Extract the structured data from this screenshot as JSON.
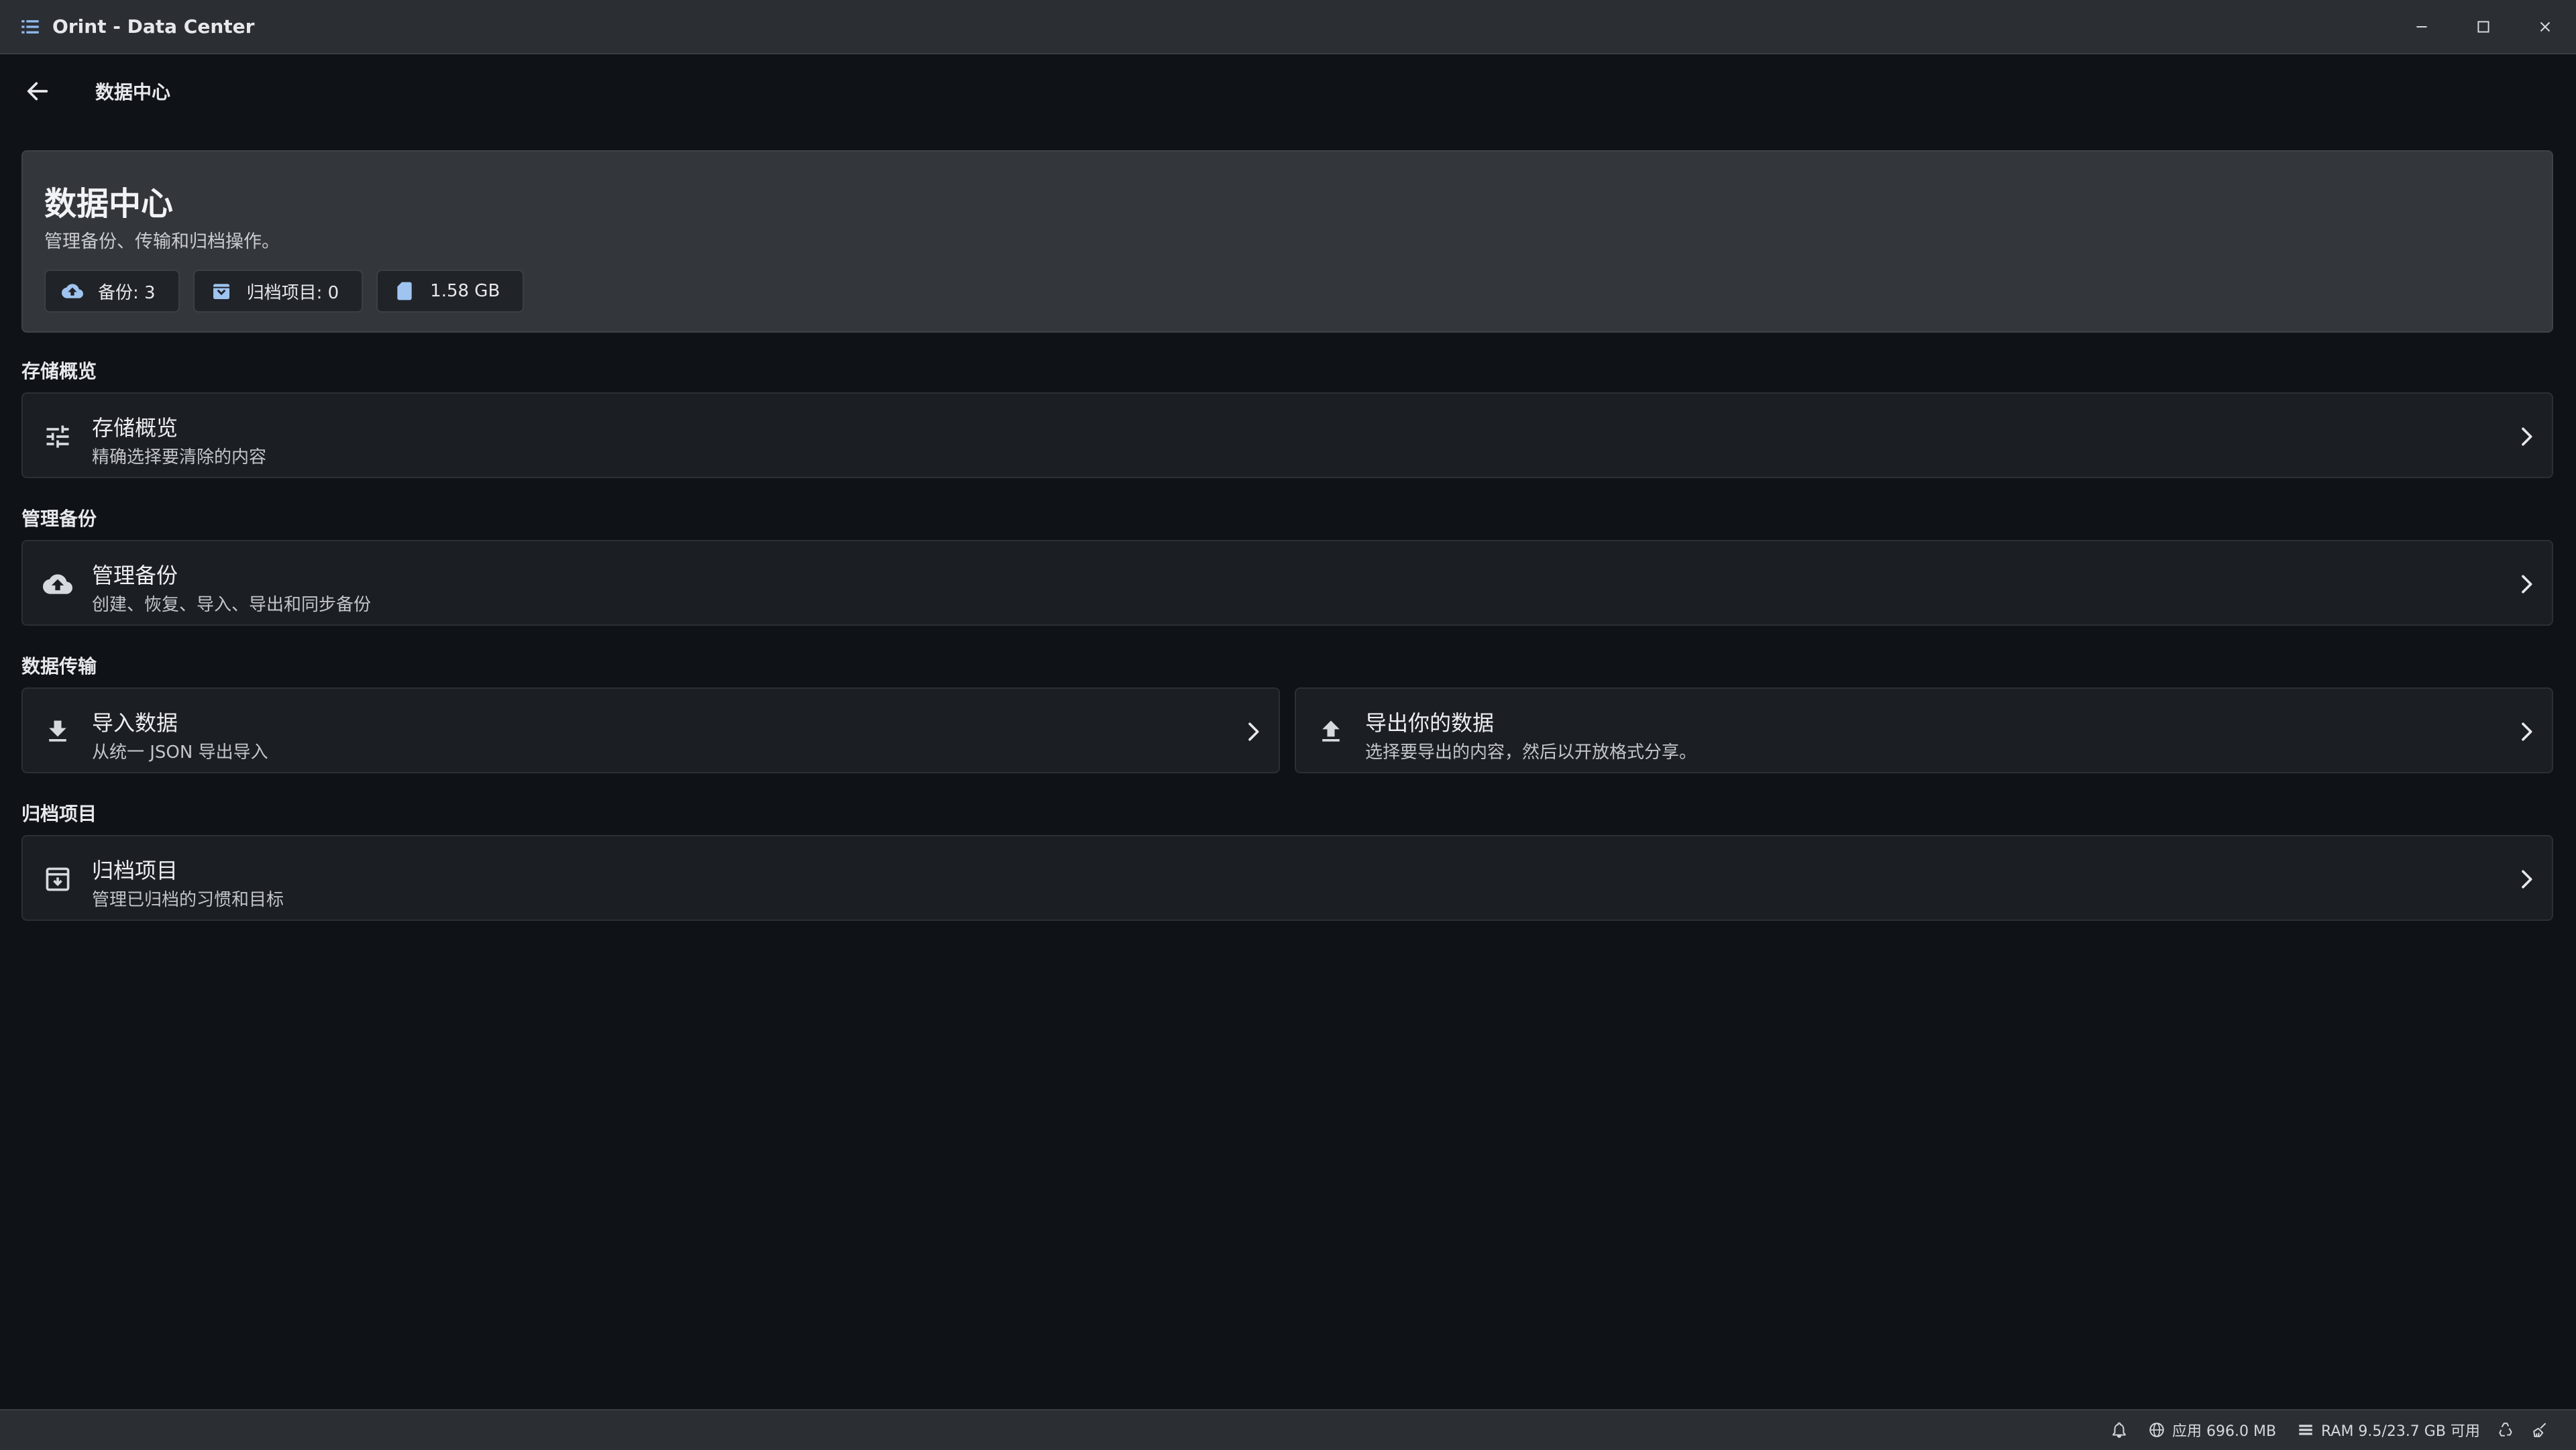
{
  "window": {
    "title": "Orint - Data Center",
    "controls": [
      "minimize-icon",
      "maximize-icon",
      "close-icon"
    ]
  },
  "header": {
    "back_icon": "arrow-left-icon",
    "title": "数据中心"
  },
  "hero": {
    "title": "数据中心",
    "subtitle": "管理备份、传输和归档操作。",
    "chips": [
      {
        "icon": "cloud-upload-icon",
        "label": "备份: 3"
      },
      {
        "icon": "archive-icon",
        "label": "归档项目: 0"
      },
      {
        "icon": "sd-card-icon",
        "label": "1.58 GB"
      }
    ]
  },
  "sections": {
    "storage": {
      "title": "存储概览",
      "card": {
        "icon": "tune-sliders-icon",
        "title": "存储概览",
        "subtitle": "精确选择要清除的内容"
      }
    },
    "backups": {
      "title": "管理备份",
      "card": {
        "icon": "cloud-upload-icon",
        "title": "管理备份",
        "subtitle": "创建、恢复、导入、导出和同步备份"
      }
    },
    "transfer": {
      "title": "数据传输",
      "import_card": {
        "icon": "download-icon",
        "title": "导入数据",
        "subtitle": "从统一 JSON 导出导入"
      },
      "export_card": {
        "icon": "upload-icon",
        "title": "导出你的数据",
        "subtitle": "选择要导出的内容，然后以开放格式分享。"
      }
    },
    "archived": {
      "title": "归档项目",
      "card": {
        "icon": "archive-box-icon",
        "title": "归档项目",
        "subtitle": "管理已归档的习惯和目标"
      }
    }
  },
  "statusbar": {
    "app_memory": "应用 696.0 MB",
    "ram": "RAM 9.5/23.7 GB 可用",
    "icons": [
      "bell-icon",
      "globe-icon",
      "list-icon",
      "recycle-icon",
      "broom-icon"
    ]
  },
  "colors": {
    "background": "#0f1217",
    "card": "#1b1e23",
    "hero": "#33363b",
    "titlebar": "#2b2e33",
    "chip_icon_accent": "#9fc4f0"
  }
}
